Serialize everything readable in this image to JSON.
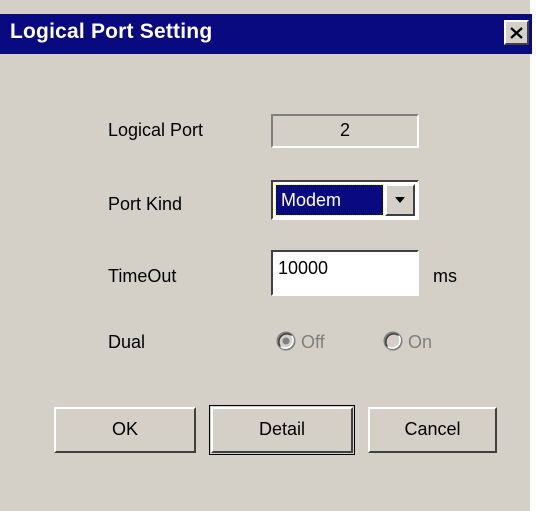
{
  "window": {
    "title": "Logical Port Setting",
    "close_glyph": "✕"
  },
  "fields": {
    "logical_port": {
      "label": "Logical Port",
      "value": "2"
    },
    "port_kind": {
      "label": "Port Kind",
      "selected": "Modem"
    },
    "timeout": {
      "label": "TimeOut",
      "value": "10000",
      "unit": "ms"
    },
    "dual": {
      "label": "Dual",
      "options": [
        {
          "label": "Off",
          "checked": true
        },
        {
          "label": "On",
          "checked": false
        }
      ]
    }
  },
  "buttons": {
    "ok": "OK",
    "detail": "Detail",
    "cancel": "Cancel"
  },
  "colors": {
    "face": "#d4d0c8",
    "titlebar": "#0a0a80",
    "disabled": "#808080"
  }
}
